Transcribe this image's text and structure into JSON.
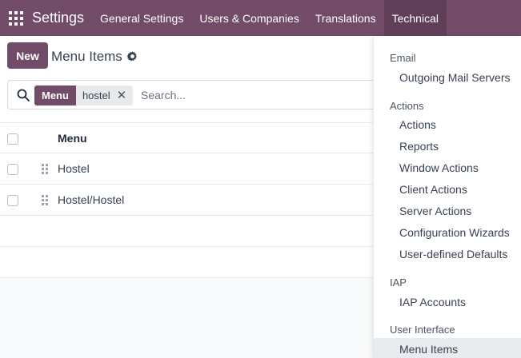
{
  "navbar": {
    "app_title": "Settings",
    "menus": [
      {
        "label": "General Settings",
        "active": false
      },
      {
        "label": "Users & Companies",
        "active": false
      },
      {
        "label": "Translations",
        "active": false
      },
      {
        "label": "Technical",
        "active": true
      }
    ]
  },
  "control_panel": {
    "new_label": "New",
    "title": "Menu Items"
  },
  "search": {
    "facet_label": "Menu",
    "facet_value": "hostel",
    "placeholder": "Search..."
  },
  "list": {
    "column_header": "Menu",
    "rows": [
      "Hostel",
      "Hostel/Hostel"
    ]
  },
  "dropdown": {
    "sections": [
      {
        "header": "Email",
        "items": [
          "Outgoing Mail Servers"
        ]
      },
      {
        "header": "Actions",
        "items": [
          "Actions",
          "Reports",
          "Window Actions",
          "Client Actions",
          "Server Actions",
          "Configuration Wizards",
          "User-defined Defaults"
        ]
      },
      {
        "header": "IAP",
        "items": [
          "IAP Accounts"
        ]
      },
      {
        "header": "User Interface",
        "items": [
          "Menu Items"
        ]
      }
    ],
    "selected_item": "Menu Items"
  },
  "colors": {
    "brand": "#714b67",
    "brand_active": "#5f3f57",
    "selected_bg": "#e9ecef"
  }
}
